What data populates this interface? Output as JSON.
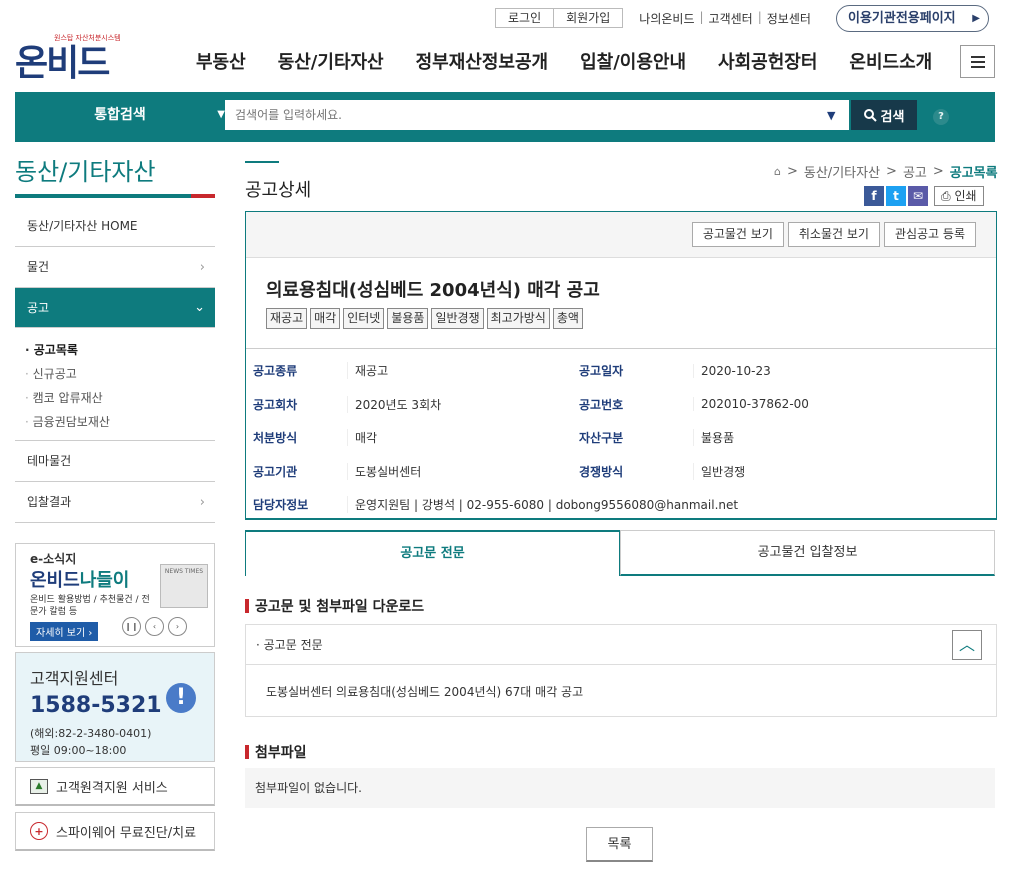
{
  "util": {
    "login": "로그인",
    "join": "회원가입",
    "links": [
      "나의온비드",
      "고객센터",
      "정보센터"
    ],
    "pill": "이용기관전용페이지"
  },
  "logo": {
    "sub": "원스탑 자산처분시스템",
    "main": "온비드"
  },
  "gnb": [
    "부동산",
    "동산/기타자산",
    "정부재산정보공개",
    "입찰/이용안내",
    "사회공헌장터",
    "온비드소개"
  ],
  "search": {
    "category": "통합검색",
    "placeholder": "검색어를 입력하세요.",
    "button": "검색",
    "help": "?"
  },
  "lnb": {
    "title": "동산/기타자산",
    "items": {
      "home": "동산/기타자산 HOME",
      "goods": "물건",
      "notice": "공고",
      "theme": "테마물건",
      "result": "입찰결과"
    },
    "subs": [
      "공고목록",
      "신규공고",
      "캠코 압류재산",
      "금융권담보재산"
    ]
  },
  "banner1": {
    "esos": "e-소식지",
    "nadeuli_a": "온비드",
    "nadeuli_b": "나들이",
    "desc": "온비드 활용방법 / 추천물건 / 전문가 칼럼 등",
    "more": "자세히 보기 ›",
    "news": "NEWS TIMES"
  },
  "banner2": {
    "title": "고객지원센터",
    "number": "1588-5321",
    "abroad": "(해외:82-2-3480-0401)",
    "hours": "평일 09:00~18:00"
  },
  "banner3": "고객원격지원 서비스",
  "banner4": "스파이웨어 무료진단/치료",
  "content": {
    "title": "공고상세",
    "breadcrumb": [
      "동산/기타자산",
      "공고",
      "공고목록"
    ],
    "print": "인쇄",
    "buttons": [
      "공고물건 보기",
      "취소물건 보기",
      "관심공고 등록"
    ],
    "notice_title": "의료용침대(성심베드 2004년식) 매각 공고",
    "tags": [
      "재공고",
      "매각",
      "인터넷",
      "불용품",
      "일반경쟁",
      "최고가방식",
      "총액"
    ],
    "info": {
      "type_label": "공고종류",
      "type": "재공고",
      "date_label": "공고일자",
      "date": "2020-10-23",
      "round_label": "공고회차",
      "round": "2020년도 3회차",
      "no_label": "공고번호",
      "no": "202010-37862-00",
      "method_label": "처분방식",
      "method": "매각",
      "asset_label": "자산구분",
      "asset": "불용품",
      "org_label": "공고기관",
      "org": "도봉실버센터",
      "comp_label": "경쟁방식",
      "comp": "일반경쟁",
      "contact_label": "담당자정보",
      "contact": "운영지원팀 | 강병석 | 02-955-6080 | dobong9556080@hanmail.net"
    },
    "tabs": [
      "공고문 전문",
      "공고물건 입찰정보"
    ],
    "sec1": "공고문 및 첨부파일 다운로드",
    "acc_head": "· 공고문 전문",
    "acc_body": "도봉실버센터 의료용침대(성심베드 2004년식) 67대 매각 공고",
    "sec2": "첨부파일",
    "attach": "첨부파일이 없습니다.",
    "list_btn": "목록"
  }
}
